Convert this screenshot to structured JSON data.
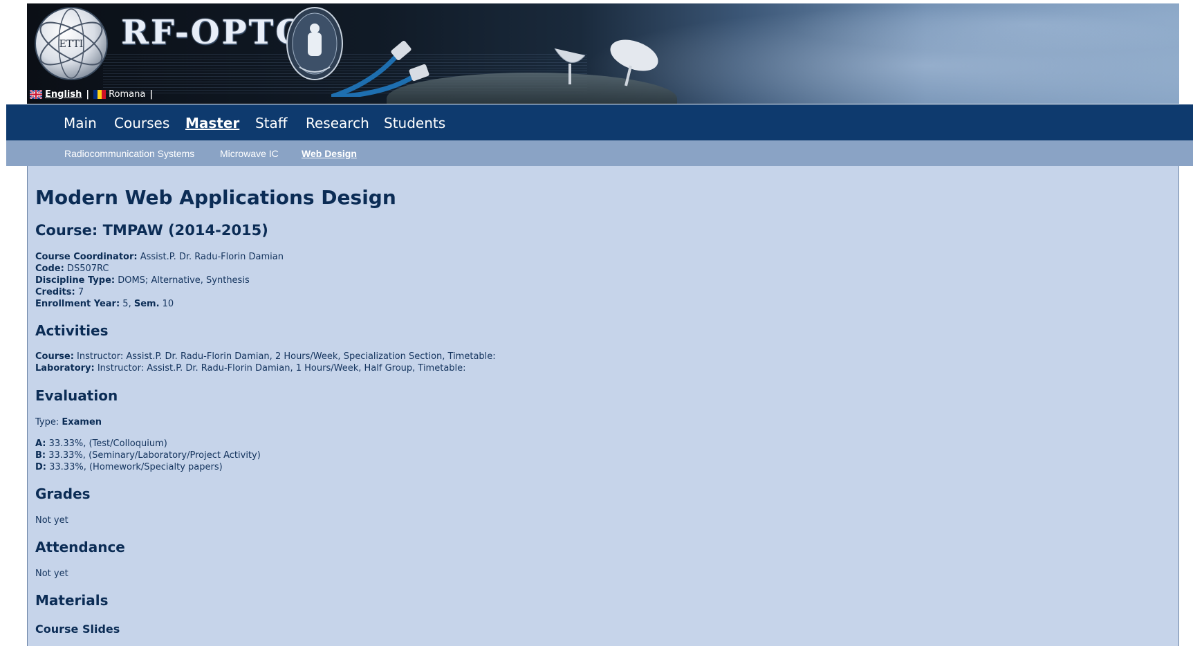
{
  "header": {
    "brand": "RF-OPTO",
    "logo_text": "ETTI",
    "languages": {
      "english": "English",
      "romana": "Romana",
      "separator": "|"
    }
  },
  "nav": {
    "items": [
      "Main",
      "Courses",
      "Master",
      "Staff",
      "Research",
      "Students"
    ],
    "active": "Master"
  },
  "subnav": {
    "items": [
      "Radiocommunication Systems",
      "Microwave IC",
      "Web Design"
    ],
    "active": "Web Design"
  },
  "page": {
    "title": "Modern Web Applications Design",
    "course_heading": "Course: TMPAW (2014-2015)",
    "info": {
      "coordinator_label": "Course Coordinator:",
      "coordinator_value": " Assist.P. Dr. Radu-Florin Damian",
      "code_label": "Code:",
      "code_value": " DS507RC",
      "discipline_label": "Discipline Type:",
      "discipline_value": " DOMS; Alternative, Synthesis",
      "credits_label": "Credits:",
      "credits_value": " 7",
      "enrollment_label": "Enrollment Year:",
      "enrollment_value": " 5, ",
      "sem_label": "Sem.",
      "sem_value": " 10"
    },
    "activities": {
      "heading": "Activities",
      "course_label": "Course:",
      "course_value": " Instructor: Assist.P. Dr. Radu-Florin Damian, 2 Hours/Week, Specialization Section, Timetable:",
      "lab_label": "Laboratory:",
      "lab_value": " Instructor: Assist.P. Dr. Radu-Florin Damian, 1 Hours/Week, Half Group, Timetable:"
    },
    "evaluation": {
      "heading": "Evaluation",
      "type_label": "Type: ",
      "type_value": "Examen",
      "a_label": "A:",
      "a_value": " 33.33%, (Test/Colloquium)",
      "b_label": "B:",
      "b_value": " 33.33%, (Seminary/Laboratory/Project Activity)",
      "d_label": "D:",
      "d_value": " 33.33%, (Homework/Specialty papers)"
    },
    "grades": {
      "heading": "Grades",
      "text": "Not yet"
    },
    "attendance": {
      "heading": "Attendance",
      "text": "Not yet"
    },
    "materials": {
      "heading": "Materials",
      "subheading": "Course Slides"
    }
  },
  "colors": {
    "nav_bg": "#0e3a6e",
    "subnav_bg": "#8aa3c5",
    "content_bg": "#c6d4ea",
    "heading": "#0b2c55"
  }
}
